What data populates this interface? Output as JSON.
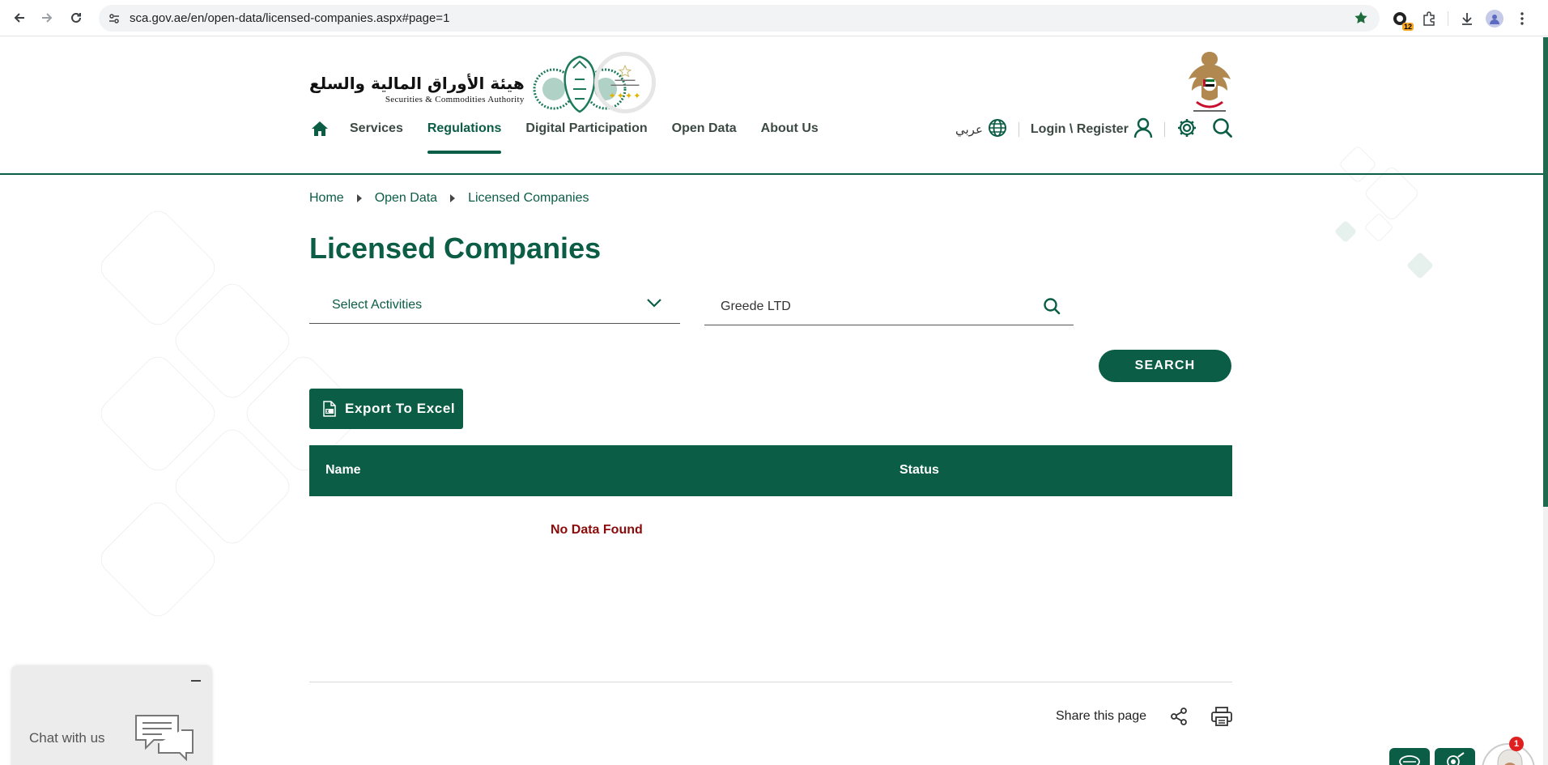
{
  "browser": {
    "url": "sca.gov.ae/en/open-data/licensed-companies.aspx#page=1",
    "extension_badge": "12"
  },
  "header": {
    "logo_arabic": "هيئة الأوراق المالية والسلع",
    "logo_english": "Securities & Commodities Authority",
    "nav": [
      {
        "label": "Services",
        "active": false
      },
      {
        "label": "Regulations",
        "active": true
      },
      {
        "label": "Digital Participation",
        "active": false
      },
      {
        "label": "Open Data",
        "active": false
      },
      {
        "label": "About Us",
        "active": false
      }
    ],
    "language_label": "عربي",
    "login_label": "Login \\ Register"
  },
  "breadcrumb": [
    "Home",
    "Open Data",
    "Licensed Companies"
  ],
  "page_title": "Licensed Companies",
  "filters": {
    "activities_label": "Select Activities",
    "search_value": "Greede LTD",
    "search_button": "SEARCH"
  },
  "export_label": "Export To Excel",
  "table": {
    "columns": [
      "Name",
      "Status"
    ],
    "empty_message": "No Data Found"
  },
  "footer": {
    "share_label": "Share this page"
  },
  "chat": {
    "label": "Chat with us"
  },
  "notification_count": "1",
  "colors": {
    "primary": "#0b5d45",
    "error": "#8b0a0a"
  }
}
